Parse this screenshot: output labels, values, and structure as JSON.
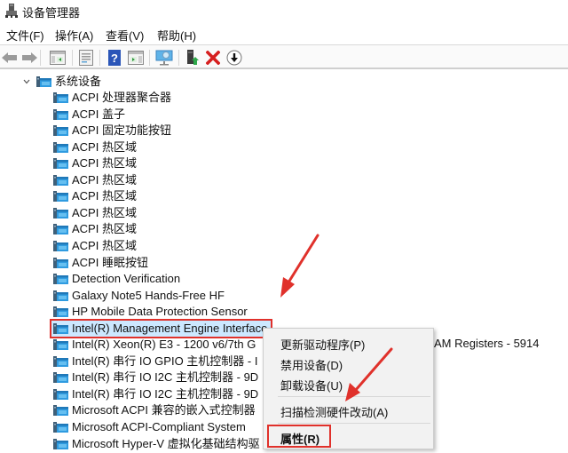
{
  "window": {
    "title": "设备管理器",
    "icon": "device-manager-icon"
  },
  "menubar": {
    "items": [
      {
        "label": "文件(F)"
      },
      {
        "label": "操作(A)"
      },
      {
        "label": "查看(V)"
      },
      {
        "label": "帮助(H)"
      }
    ]
  },
  "toolbar": {
    "buttons": [
      {
        "name": "back",
        "icon": "arrow-left-icon"
      },
      {
        "name": "forward",
        "icon": "arrow-right-icon"
      },
      {
        "name": "show-hide-console-tree",
        "icon": "console-tree-icon"
      },
      {
        "name": "properties",
        "icon": "properties-icon"
      },
      {
        "name": "help",
        "icon": "help-icon",
        "glyph": "?"
      },
      {
        "name": "show-hide-action-pane",
        "icon": "action-pane-icon"
      },
      {
        "name": "scan-hardware",
        "icon": "scan-monitor-icon"
      },
      {
        "name": "update-driver",
        "icon": "update-driver-icon"
      },
      {
        "name": "uninstall-device",
        "icon": "uninstall-x-icon",
        "glyph": "✕"
      },
      {
        "name": "disable-device",
        "icon": "disable-down-arrow-icon",
        "glyph": "↓"
      }
    ]
  },
  "tree": {
    "category": {
      "label": "系统设备",
      "expanded": true,
      "icon": "system-device-icon"
    },
    "children": [
      {
        "label": "ACPI 处理器聚合器"
      },
      {
        "label": "ACPI 盖子"
      },
      {
        "label": "ACPI 固定功能按钮"
      },
      {
        "label": "ACPI 热区域"
      },
      {
        "label": "ACPI 热区域"
      },
      {
        "label": "ACPI 热区域"
      },
      {
        "label": "ACPI 热区域"
      },
      {
        "label": "ACPI 热区域"
      },
      {
        "label": "ACPI 热区域"
      },
      {
        "label": "ACPI 热区域"
      },
      {
        "label": "ACPI 睡眠按钮"
      },
      {
        "label": "Detection Verification"
      },
      {
        "label": "Galaxy Note5 Hands-Free HF"
      },
      {
        "label": "HP Mobile Data Protection Sensor"
      },
      {
        "label": "Intel(R) Management Engine Interface",
        "selected": true
      },
      {
        "label": "Intel(R) Xeon(R) E3 - 1200 v6/7th G",
        "trailing": "AM Registers - 5914"
      },
      {
        "label": "Intel(R) 串行 IO GPIO 主机控制器 - I"
      },
      {
        "label": "Intel(R) 串行 IO I2C 主机控制器 - 9D"
      },
      {
        "label": "Intel(R) 串行 IO I2C 主机控制器 - 9D"
      },
      {
        "label": "Microsoft ACPI 兼容的嵌入式控制器"
      },
      {
        "label": "Microsoft ACPI-Compliant System"
      },
      {
        "label": "Microsoft Hyper-V 虚拟化基础结构驱"
      }
    ]
  },
  "context_menu": {
    "items": [
      {
        "label": "更新驱动程序(P)"
      },
      {
        "label": "禁用设备(D)"
      },
      {
        "label": "卸载设备(U)"
      },
      {
        "separator": true
      },
      {
        "label": "扫描检测硬件改动(A)"
      },
      {
        "separator": true
      },
      {
        "label": "属性(R)",
        "bold": true,
        "highlighted": true
      }
    ]
  },
  "annotations": {
    "highlight_color": "#e0312b",
    "arrow_color": "#e0312b"
  },
  "colors": {
    "selection_bg": "#cce8ff",
    "menu_bg": "#f2f2f2"
  }
}
